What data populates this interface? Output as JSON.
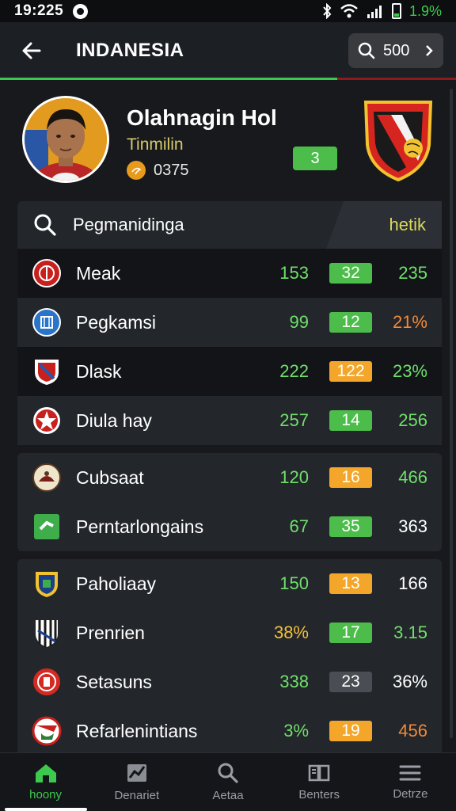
{
  "status_bar": {
    "time": "19:225",
    "battery": "1.9%"
  },
  "header": {
    "title": "INDANESIA",
    "search_value": "500"
  },
  "profile": {
    "name": "Olahnagin Hol",
    "subtitle": "Tinmilin",
    "coins": "0375",
    "badge": "3"
  },
  "list": {
    "header_label": "Pegmanidinga",
    "header_tab": "hetik",
    "rows": [
      {
        "name": "Meak",
        "v1": "153",
        "v1_color": "#6fe06a",
        "badge": "32",
        "badge_color": "#4cbd4a",
        "v3": "235",
        "v3_color": "#6fe06a",
        "crest": "crest-red-circle"
      },
      {
        "name": "Pegkamsi",
        "v1": "99",
        "v1_color": "#6fe06a",
        "badge": "12",
        "badge_color": "#4cbd4a",
        "v3": "21%",
        "v3_color": "#f08a3a",
        "crest": "crest-blue-circle"
      },
      {
        "name": "Dlask",
        "v1": "222",
        "v1_color": "#6fe06a",
        "badge": "122",
        "badge_color": "#f3a629",
        "v3": "23%",
        "v3_color": "#6fe06a",
        "crest": "crest-red-shield"
      },
      {
        "name": "Diula hay",
        "v1": "257",
        "v1_color": "#6fe06a",
        "badge": "14",
        "badge_color": "#4cbd4a",
        "v3": "256",
        "v3_color": "#6fe06a",
        "crest": "crest-red-star"
      },
      {
        "name": "Cubsaat",
        "v1": "120",
        "v1_color": "#6fe06a",
        "badge": "16",
        "badge_color": "#f3a629",
        "v3": "466",
        "v3_color": "#6fe06a",
        "crest": "crest-cream-circle"
      },
      {
        "name": "Perntarlongains",
        "v1": "67",
        "v1_color": "#6fe06a",
        "badge": "35",
        "badge_color": "#4cbd4a",
        "v3": "363",
        "v3_color": "#ffffff",
        "crest": "crest-green-square"
      },
      {
        "name": "Paholiaay",
        "v1": "150",
        "v1_color": "#6fe06a",
        "badge": "13",
        "badge_color": "#f3a629",
        "v3": "166",
        "v3_color": "#ffffff",
        "crest": "crest-blue-shield"
      },
      {
        "name": "Prenrien",
        "v1": "38%",
        "v1_color": "#f3c13a",
        "badge": "17",
        "badge_color": "#4cbd4a",
        "v3": "3.15",
        "v3_color": "#6fe06a",
        "crest": "crest-striped-shield"
      },
      {
        "name": "Setasuns",
        "v1": "338",
        "v1_color": "#6fe06a",
        "badge": "23",
        "badge_color": "#4a4d53",
        "v3": "36%",
        "v3_color": "#ffffff",
        "crest": "crest-red-circle-2"
      },
      {
        "name": "Refarlenintians",
        "v1": "3%",
        "v1_color": "#6fe06a",
        "badge": "19",
        "badge_color": "#f3a629",
        "v3": "456",
        "v3_color": "#f08a3a",
        "crest": "crest-red-white-circle"
      }
    ]
  },
  "bottom_nav": [
    {
      "label": "hoony",
      "icon": "home-icon"
    },
    {
      "label": "Denariet",
      "icon": "chart-icon"
    },
    {
      "label": "Aetaa",
      "icon": "search-icon"
    },
    {
      "label": "Benters",
      "icon": "book-icon"
    },
    {
      "label": "Detrze",
      "icon": "menu-icon"
    }
  ]
}
